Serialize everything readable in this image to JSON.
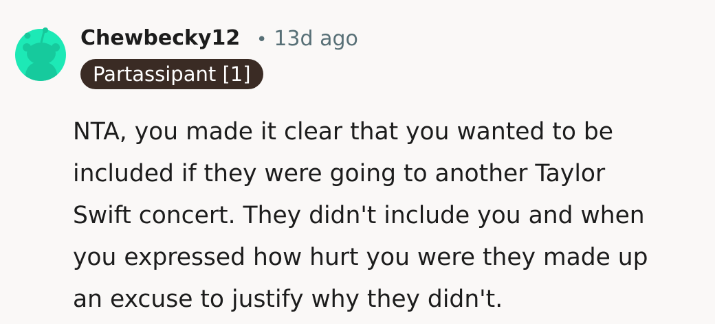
{
  "comment": {
    "avatar_icon": "snoo-avatar-icon",
    "avatar_color": "#1de9b6",
    "username": "Chewbecky12",
    "separator": "•",
    "timestamp": "13d ago",
    "flair": "Partassipant [1]",
    "flair_color": "#3a2b24",
    "body_lines": [
      "NTA, you made it clear that you wanted to be",
      "included if they were going to another Taylor",
      "Swift concert. They didn't include you and when",
      "you expressed how hurt you were they made up",
      "an excuse to justify why they didn't."
    ]
  }
}
